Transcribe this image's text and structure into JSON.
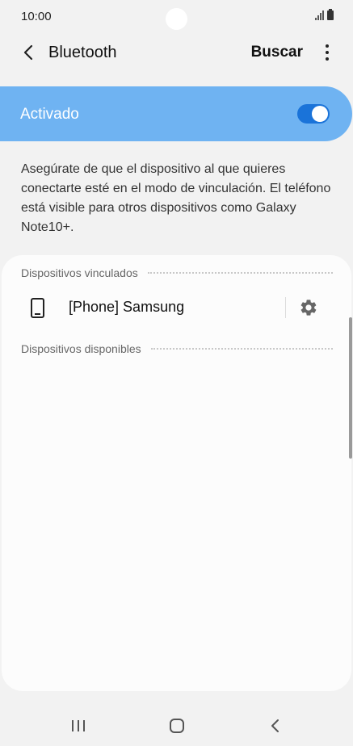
{
  "status_bar": {
    "time": "10:00",
    "icons": [
      "signal-icon",
      "battery-icon"
    ]
  },
  "app_bar": {
    "title": "Bluetooth",
    "scan_label": "Buscar",
    "icons": [
      "back-arrow-icon",
      "more-options-icon"
    ]
  },
  "master_switch": {
    "label": "Activado",
    "checked": true,
    "track_color": "#1a73d9",
    "bar_color": "#6fb3f2"
  },
  "info_text": "Asegúrate de que el dispositivo al que quieres conectarte esté en el modo de vinculación. El teléfono está visible para otros dispositivos como Galaxy Note10+.",
  "paired_section": {
    "header": "Dispositivos vinculados",
    "devices": [
      {
        "name": "[Phone] Samsung",
        "icon": "smartphone-icon",
        "settings_icon": "gear-icon"
      }
    ]
  },
  "available_section": {
    "header": "Dispositivos disponibles"
  },
  "nav_bar": {
    "icons": [
      "recent-apps-icon",
      "home-icon",
      "back-icon"
    ]
  }
}
